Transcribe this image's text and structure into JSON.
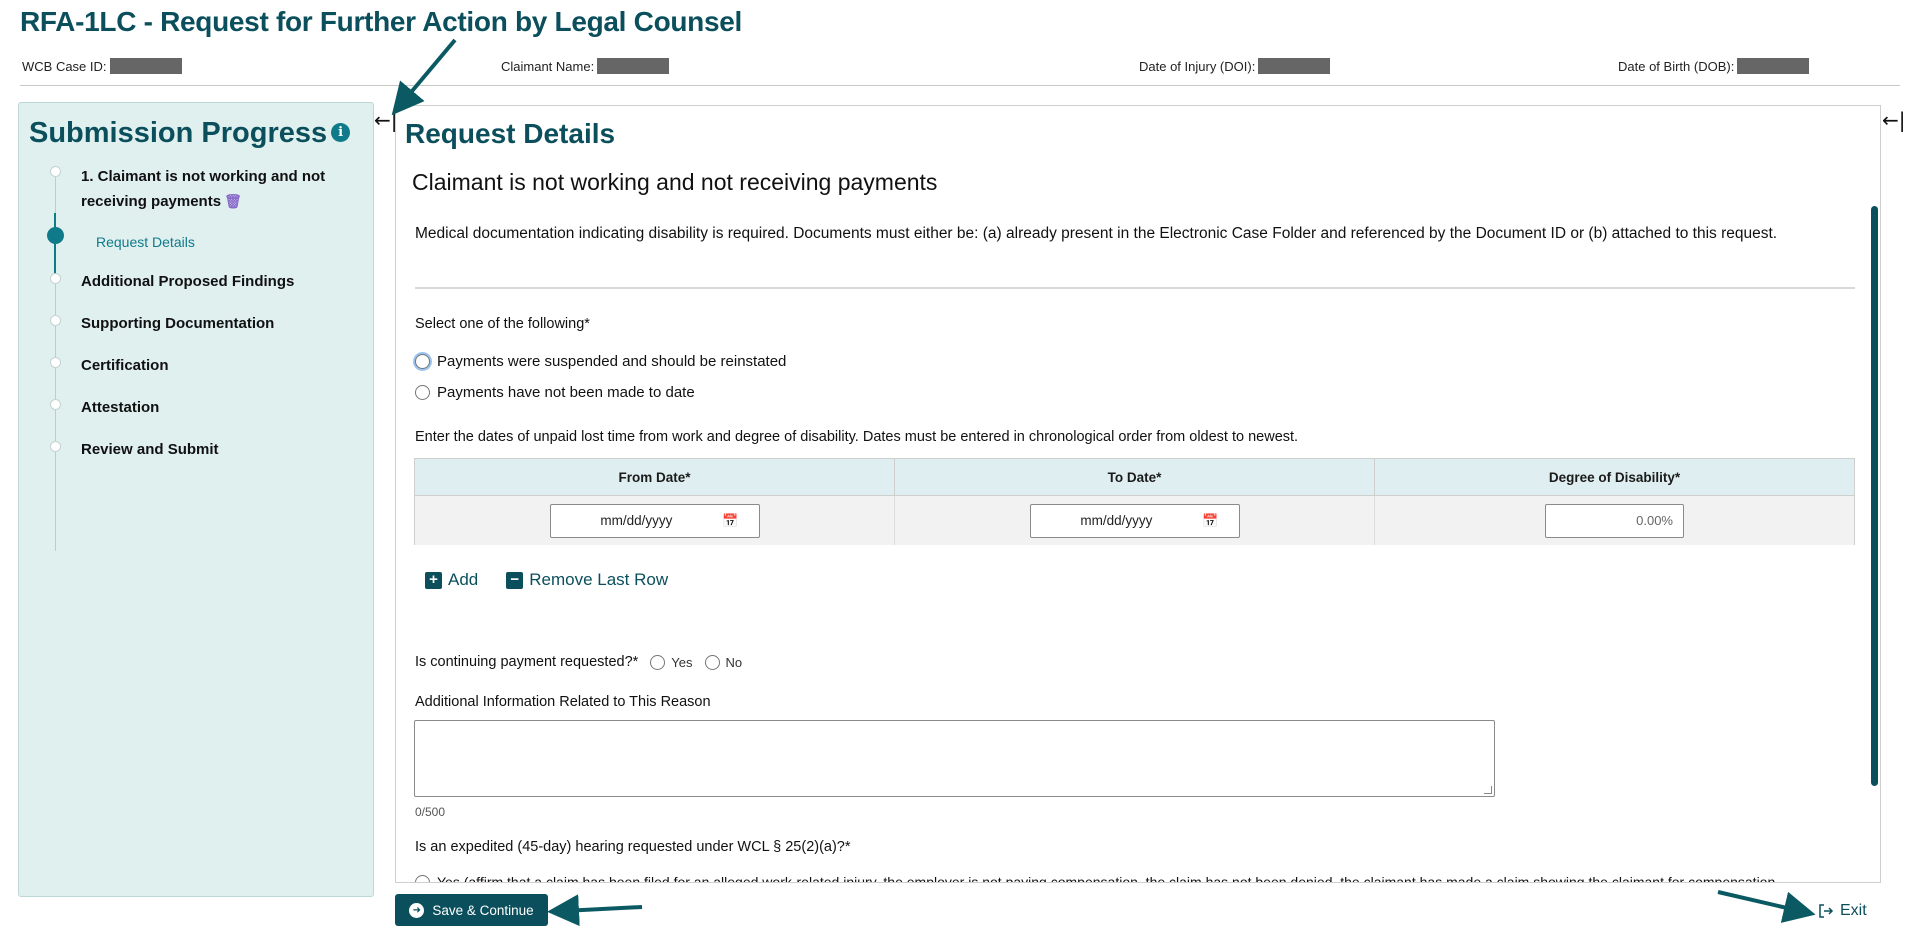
{
  "page": {
    "title": "RFA-1LC - Request for Further Action by Legal Counsel"
  },
  "case_bar": {
    "case_id_label": "WCB Case ID:",
    "claimant_name_label": "Claimant Name:",
    "doi_label": "Date of Injury (DOI):",
    "dob_label": "Date of Birth (DOB):"
  },
  "sidebar": {
    "title": "Submission Progress",
    "info_icon": "i",
    "steps": [
      {
        "label": "1. Claimant is not working and not",
        "label2": "receiving payments"
      },
      {
        "label": "Additional Proposed Findings"
      },
      {
        "label": "Supporting Documentation"
      },
      {
        "label": "Certification"
      },
      {
        "label": "Attestation"
      },
      {
        "label": "Review and Submit"
      }
    ],
    "substep": "Request Details",
    "collapse_glyph": "←|"
  },
  "main": {
    "title": "Request Details",
    "subtitle": "Claimant is not working and not receiving payments",
    "notice": "Medical documentation indicating disability is required. Documents must either be: (a) already present in the Electronic Case Folder and referenced by the Document ID or (b) attached to this request.",
    "select_label": "Select one of the following*",
    "options": [
      "Payments were suspended and should be reinstated",
      "Payments have not been made to date"
    ],
    "dates_instruction": "Enter the dates of unpaid lost time from work and degree of disability. Dates must be entered in chronological order from oldest to newest.",
    "table": {
      "headers": [
        "From Date*",
        "To Date*",
        "Degree of Disability*"
      ],
      "from_placeholder": "mm/dd/yyyy",
      "to_placeholder": "mm/dd/yyyy",
      "degree_placeholder": "0.00%"
    },
    "add_label": "Add",
    "remove_label": "Remove Last Row",
    "continuing_label": "Is continuing payment requested?*",
    "yes_label": "Yes",
    "no_label": "No",
    "additional_info_label": "Additional Information Related to This Reason",
    "char_counter": "0/500",
    "expedited_label": "Is an expedited (45-day) hearing requested under WCL § 25(2)(a)?*",
    "cutoff_option": "Yes (affirm that a claim has been filed for an alleged work-related injury, the employer is not paying compensation, the claim has not been denied, the claimant has made a claim showing the claimant for compensation"
  },
  "footer": {
    "save_label": "Save & Continue",
    "exit_label": "Exit"
  },
  "colors": {
    "brand": "#0b4f5c",
    "accent": "#0f7a8a",
    "sidebar_bg": "#e0f0ef",
    "annotation_arrow": "#0b5a63"
  }
}
